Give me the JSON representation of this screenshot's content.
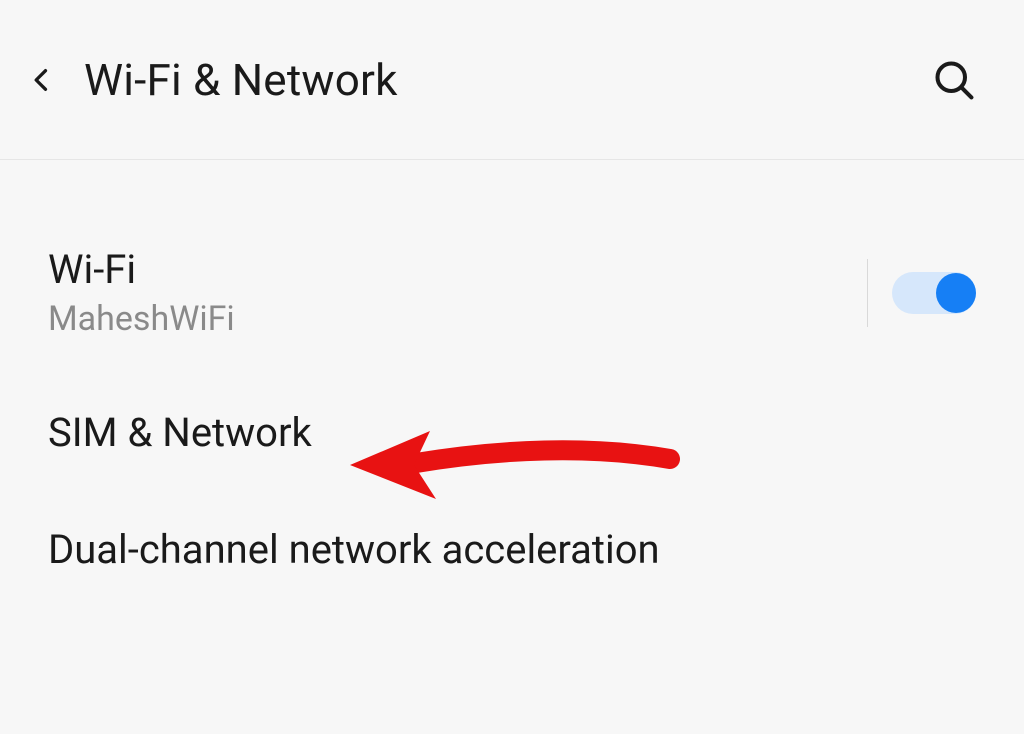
{
  "header": {
    "title": "Wi-Fi & Network"
  },
  "items": [
    {
      "title": "Wi-Fi",
      "subtitle": "MaheshWiFi",
      "toggle_on": true
    },
    {
      "title": "SIM & Network"
    },
    {
      "title": "Dual-channel network acceleration"
    }
  ],
  "annotation": {
    "target": "SIM & Network",
    "color": "#e81212"
  }
}
